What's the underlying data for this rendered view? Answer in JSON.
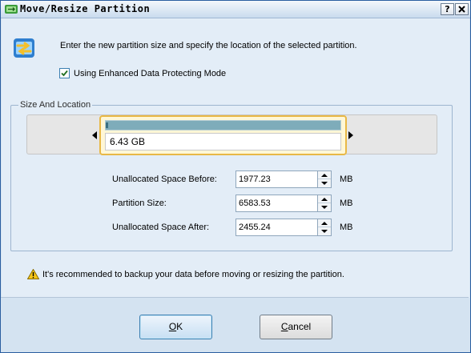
{
  "window": {
    "title": "Move/Resize Partition",
    "help_button": "?",
    "close_button": "X"
  },
  "intro_text": "Enter the new partition size and specify the location of the selected partition.",
  "protect_mode": {
    "label": "Using Enhanced Data Protecting Mode",
    "checked": true
  },
  "size_location": {
    "group_label": "Size And Location",
    "partition_size_display": "6.43 GB",
    "used_fraction": 0.01,
    "fields": [
      {
        "label": "Unallocated Space Before:",
        "value": "1977.23",
        "unit": "MB"
      },
      {
        "label": "Partition Size:",
        "value": "6583.53",
        "unit": "MB"
      },
      {
        "label": "Unallocated Space After:",
        "value": "2455.24",
        "unit": "MB"
      }
    ]
  },
  "warning_text": "It's recommended to backup your data before moving or resizing the partition.",
  "buttons": {
    "ok_accel": "O",
    "ok_rest": "K",
    "cancel_accel": "C",
    "cancel_rest": "ancel"
  },
  "colors": {
    "partition_bar": "#7eacba",
    "handle_border": "#e8b846",
    "title_bar": "#c9dbee"
  },
  "icons": {
    "title": "partition-app-icon",
    "header": "move-resize-icon",
    "warning": "warning-icon"
  }
}
